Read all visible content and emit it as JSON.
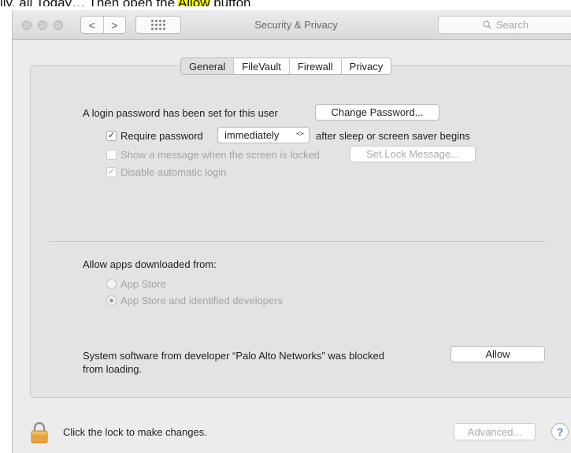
{
  "caption": {
    "text_before": "ily, all Today… Then open the ",
    "highlight": "Allow",
    "text_after": " button"
  },
  "window": {
    "title": "Security & Privacy",
    "back_glyph": "<",
    "forward_glyph": ">",
    "search_placeholder": "Search"
  },
  "tabs": [
    {
      "label": "General",
      "active": true
    },
    {
      "label": "FileVault",
      "active": false
    },
    {
      "label": "Firewall",
      "active": false
    },
    {
      "label": "Privacy",
      "active": false
    }
  ],
  "general": {
    "login_password_text": "A login password has been set for this user",
    "change_password_label": "Change Password...",
    "require_password": {
      "label": "Require password",
      "checked": true
    },
    "require_select_value": "immediately",
    "after_sleep_text": "after sleep or screen saver begins",
    "show_message": {
      "label": "Show a message when the screen is locked",
      "checked": false,
      "enabled": false
    },
    "set_lock_message_label": "Set Lock Message...",
    "disable_auto_login": {
      "label": "Disable automatic login",
      "checked": true,
      "enabled": false
    },
    "allow_apps_title": "Allow apps downloaded from:",
    "radio_options": [
      {
        "label": "App Store",
        "selected": false
      },
      {
        "label": "App Store and identified developers",
        "selected": true
      }
    ],
    "blocked_text_line1": "System software from developer “Palo Alto Networks” was blocked",
    "blocked_text_line2": "from loading.",
    "allow_label": "Allow"
  },
  "footer": {
    "lock_text": "Click the lock to make changes.",
    "advanced_label": "Advanced...",
    "help_label": "?"
  },
  "icons": {
    "lock": "lock-icon",
    "search": "search-icon",
    "grid": "grid-icon"
  },
  "colors": {
    "lock_accent": "#e8a43d",
    "help_accent": "#5a86c9",
    "caption_highlight": "#ffff00"
  }
}
